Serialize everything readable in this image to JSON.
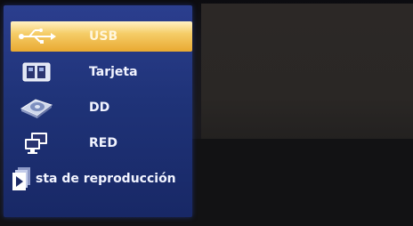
{
  "menu": {
    "selected_index": 0,
    "items": [
      {
        "label": "USB",
        "icon": "usb-icon"
      },
      {
        "label": "Tarjeta",
        "icon": "memory-card-icon"
      },
      {
        "label": "DD",
        "icon": "hard-disk-icon"
      },
      {
        "label": "RED",
        "icon": "network-computer-icon"
      },
      {
        "label": "sta de reproducción",
        "icon": "playlist-icon"
      }
    ]
  },
  "colors": {
    "menu_background": "#1f3378",
    "selection_highlight": "#f5cd68",
    "label_text": "#f2f4ff"
  }
}
